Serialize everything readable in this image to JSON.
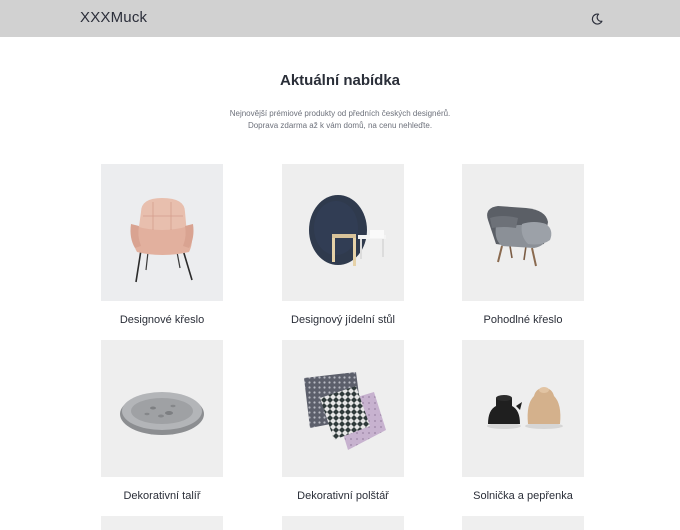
{
  "navbar": {
    "brand": "XXXMuck",
    "theme_toggle_icon": "moon-icon"
  },
  "header": {
    "title": "Aktuální nabídka",
    "subtitle_line1": "Nejnovější prémiové produkty od předních českých designérů.",
    "subtitle_line2": "Doprava zdarma až k vám domů, na cenu nehleďte."
  },
  "products": [
    {
      "name": "Designové křeslo",
      "image": "pink-armchair"
    },
    {
      "name": "Designový jídelní stůl",
      "image": "round-dining-table"
    },
    {
      "name": "Pohodlné křeslo",
      "image": "grey-lounge-chair"
    },
    {
      "name": "Dekorativní talíř",
      "image": "decorative-plate"
    },
    {
      "name": "Dekorativní polštář",
      "image": "patterned-cushions"
    },
    {
      "name": "Solnička a pepřenka",
      "image": "salt-pepper-shakers"
    }
  ],
  "colors": {
    "navbar_bg": "#d1d1d1",
    "card_bg": "#efefef",
    "text": "#2a2e38",
    "muted_text": "#6d717b"
  }
}
